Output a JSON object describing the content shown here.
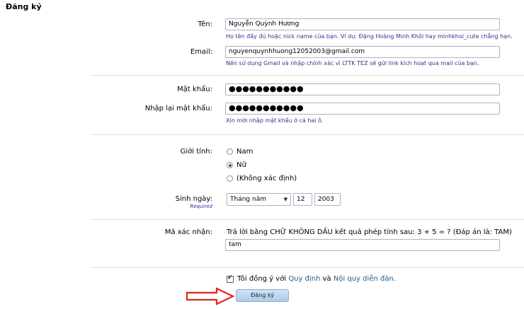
{
  "page": {
    "title": "Đăng ký"
  },
  "form": {
    "name": {
      "label": "Tên:",
      "value": "Nguyễn Quỳnh Hương",
      "hint": "Họ tên đầy đủ hoặc nick name của bạn. Ví dụ: Đặng Hoàng Minh Khôi hay minhkhoi_cute chẳng hạn."
    },
    "email": {
      "label": "Email:",
      "value": "nguyenquynhhuong12052003@gmail.com",
      "hint": "Nên sử dụng Gmail và nhập chính xác vì LTTK TEZ sẽ gửi link kích hoạt qua mail của bạn."
    },
    "password": {
      "label": "Mật khẩu:",
      "value": "●●●●●●●●●●●"
    },
    "password_confirm": {
      "label": "Nhập lại mật khẩu:",
      "value": "●●●●●●●●●●●",
      "hint": "Xin mời nhập mật khẩu ở cả hai ô."
    },
    "gender": {
      "label": "Giới tính:",
      "options": [
        {
          "label": "Nam",
          "checked": false
        },
        {
          "label": "Nữ",
          "checked": true
        },
        {
          "label": "(Không xác định)",
          "checked": false
        }
      ]
    },
    "birthday": {
      "label": "Sinh ngày:",
      "required": "Required",
      "month": "Tháng năm",
      "day": "12",
      "year": "2003"
    },
    "captcha": {
      "label": "Mã xác nhận:",
      "question": "Trả lời bằng CHỮ KHÔNG DẤU kết quả phép tính sau: 3 + 5 = ? (Đáp án là: TAM)",
      "value": "tam"
    },
    "agree": {
      "prefix": "Tôi đồng ý với",
      "link1": "Quy định",
      "conj": "và",
      "link2": "Nội quy diễn đàn."
    },
    "submit_label": "Đăng ký"
  },
  "colors": {
    "hint": "#3b2f8c",
    "button_top": "#cfe2f5",
    "button_bottom": "#aecbe9",
    "arrow": "#e8231d"
  }
}
